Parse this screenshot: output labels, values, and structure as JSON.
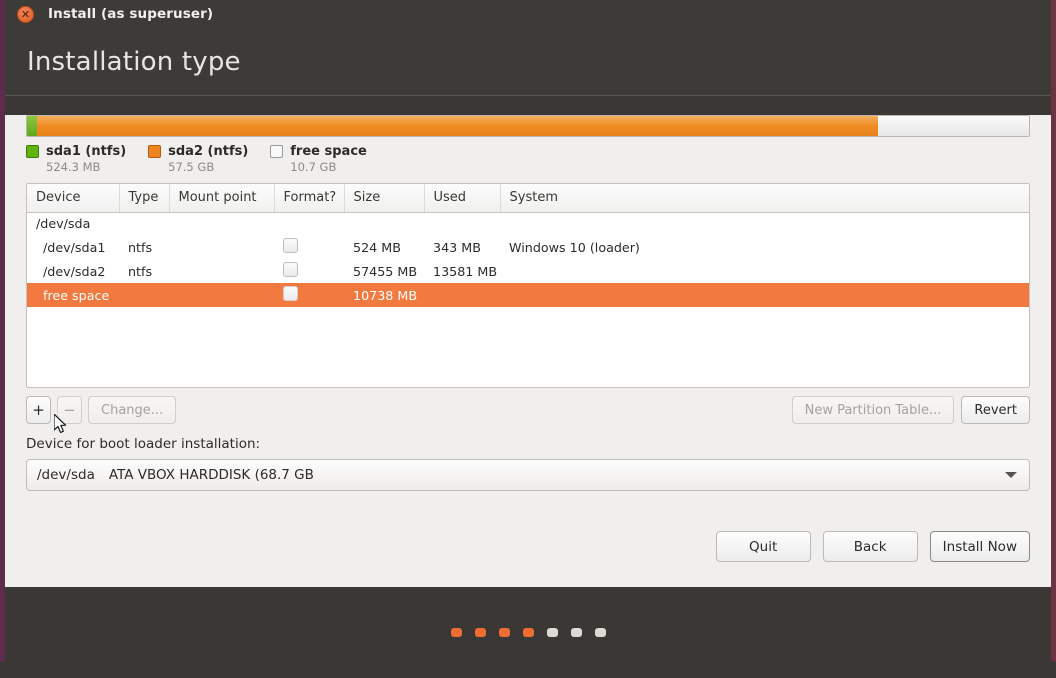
{
  "window": {
    "title": "Install (as superuser)",
    "close_icon": "close-icon",
    "heading": "Installation type"
  },
  "partition_bar": {
    "segments": [
      {
        "name": "sda1",
        "color": "#5fb50e",
        "percent": 1.0
      },
      {
        "name": "sda2",
        "color": "#ef8521",
        "percent": 83.9
      },
      {
        "name": "free space",
        "color": "#fafafa",
        "percent": 15.1
      }
    ]
  },
  "legend": [
    {
      "label": "sda1 (ntfs)",
      "size": "524.3 MB",
      "swatch": "#5fb50e"
    },
    {
      "label": "sda2 (ntfs)",
      "size": "57.5 GB",
      "swatch": "#ef8521"
    },
    {
      "label": "free space",
      "size": "10.7 GB",
      "swatch": "#fafafa"
    }
  ],
  "table": {
    "columns": [
      "Device",
      "Type",
      "Mount point",
      "Format?",
      "Size",
      "Used",
      "System"
    ],
    "rows": [
      {
        "device": "/dev/sda",
        "type": "",
        "mount": "",
        "format": false,
        "has_format": false,
        "size": "",
        "used": "",
        "system": "",
        "selected": false,
        "indent": false
      },
      {
        "device": "/dev/sda1",
        "type": "ntfs",
        "mount": "",
        "format": false,
        "has_format": true,
        "size": "524 MB",
        "used": "343 MB",
        "system": "Windows 10 (loader)",
        "selected": false,
        "indent": true
      },
      {
        "device": "/dev/sda2",
        "type": "ntfs",
        "mount": "",
        "format": false,
        "has_format": true,
        "size": "57455 MB",
        "used": "13581 MB",
        "system": "",
        "selected": false,
        "indent": true
      },
      {
        "device": "free space",
        "type": "",
        "mount": "",
        "format": false,
        "has_format": true,
        "size": "10738 MB",
        "used": "",
        "system": "",
        "selected": true,
        "indent": true
      }
    ]
  },
  "partition_buttons": {
    "add": "+",
    "remove": "−",
    "change": "Change...",
    "new_table": "New Partition Table...",
    "revert": "Revert"
  },
  "bootloader": {
    "label": "Device for boot loader installation:",
    "device": "/dev/sda",
    "description": "ATA VBOX HARDDISK (68.7 GB",
    "arrow_icon": "chevron-down-icon"
  },
  "actions": {
    "quit": "Quit",
    "back": "Back",
    "install": "Install Now"
  },
  "progress_dots": {
    "total": 7,
    "active": 4,
    "on_color": "#ef6c33",
    "off_color": "#ddd9d5"
  }
}
